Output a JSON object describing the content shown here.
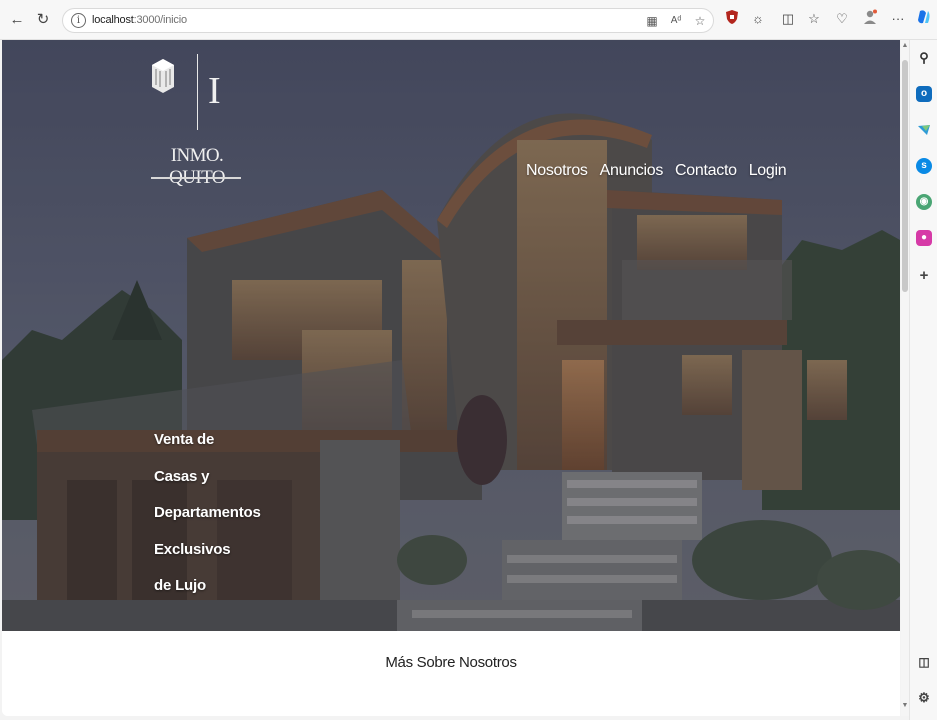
{
  "browser": {
    "url_host": "localhost",
    "url_path": ":3000/inicio",
    "back_icon": "back-arrow-icon",
    "refresh_icon": "refresh-icon",
    "more_label": "···"
  },
  "site": {
    "logo_letter": "I",
    "logo_name": "INMO. QUITO"
  },
  "nav": {
    "items": [
      {
        "label": "Nosotros"
      },
      {
        "label": "Anuncios"
      },
      {
        "label": "Contacto"
      },
      {
        "label": "Login"
      }
    ]
  },
  "hero": {
    "tagline": [
      "Venta de",
      "Casas y",
      "Departamentos",
      "Exclusivos",
      "de Lujo"
    ]
  },
  "about": {
    "title": "Más Sobre Nosotros"
  },
  "colors": {
    "sky": "#4b5064",
    "wood": "#6d4a33",
    "accent_red": "#b3261e",
    "edge_blue": "#1a73e8"
  }
}
